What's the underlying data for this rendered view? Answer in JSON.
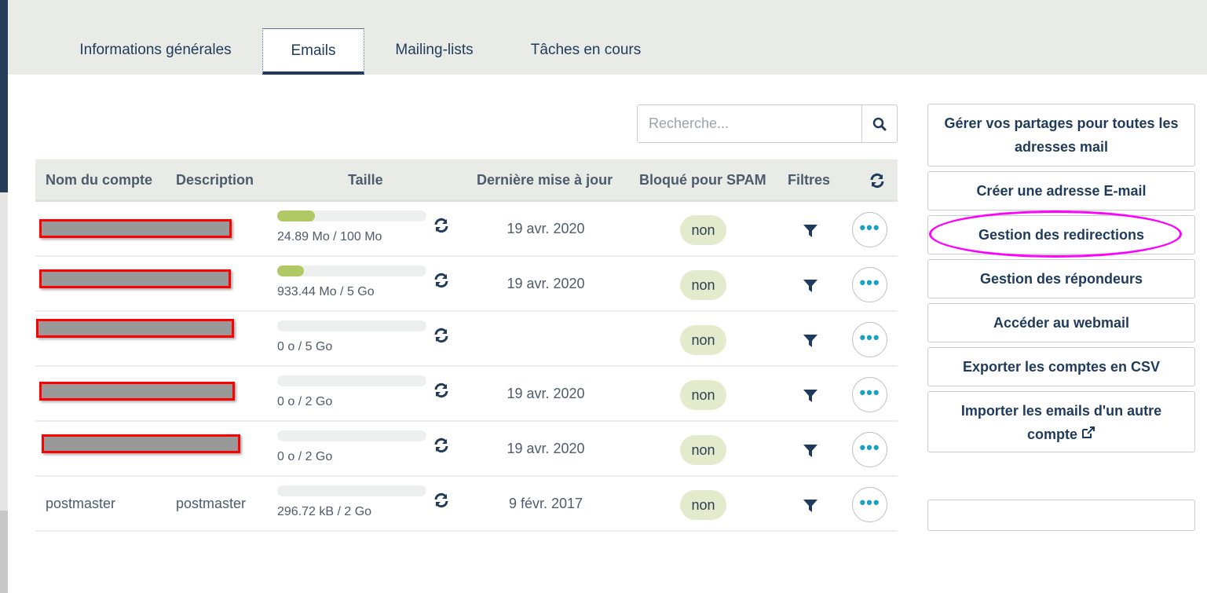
{
  "tabs": [
    "Informations générales",
    "Emails",
    "Mailing-lists",
    "Tâches en cours"
  ],
  "search": {
    "placeholder": "Recherche..."
  },
  "columns": [
    "Nom du compte",
    "Description",
    "Taille",
    "Dernière mise à jour",
    "Bloqué pour SPAM",
    "Filtres"
  ],
  "rows": [
    {
      "name": "",
      "description": "",
      "usage_percent": 25,
      "size": "24.89 Mo / 100 Mo",
      "date": "19 avr. 2020",
      "spam": "non"
    },
    {
      "name": "",
      "description": "",
      "usage_percent": 18,
      "size": "933.44 Mo / 5 Go",
      "date": "19 avr. 2020",
      "spam": "non"
    },
    {
      "name": "",
      "description": "",
      "usage_percent": 0,
      "size": "0 o / 5 Go",
      "date": "",
      "spam": "non"
    },
    {
      "name": "",
      "description": "",
      "usage_percent": 0,
      "size": "0 o / 2 Go",
      "date": "19 avr. 2020",
      "spam": "non"
    },
    {
      "name": "",
      "description": "",
      "usage_percent": 0,
      "size": "0 o / 2 Go",
      "date": "19 avr. 2020",
      "spam": "non"
    },
    {
      "name": "postmaster",
      "description": "postmaster",
      "usage_percent": 0,
      "size": "296.72 kB / 2 Go",
      "date": "9 févr. 2017",
      "spam": "non"
    }
  ],
  "actions": [
    "Gérer vos partages pour toutes les adresses mail",
    "Créer une adresse E-mail",
    "Gestion des redirections",
    "Gestion des répondeurs",
    "Accéder au webmail",
    "Exporter les comptes en CSV",
    "Importer les emails d'un autre compte"
  ],
  "colors": {
    "accent": "#1f3a5a",
    "bar": "#b0c965",
    "highlight": "#ff00ff"
  }
}
